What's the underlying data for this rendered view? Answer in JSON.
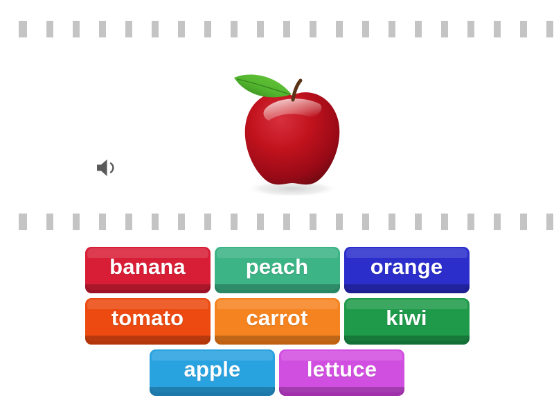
{
  "page": {
    "background_color": "#ffffff",
    "separator_color": "#c4c4c4"
  },
  "prompt": {
    "audio_button": {
      "icon": "speaker-icon",
      "label": "Play audio",
      "color": "#5a5a5a"
    },
    "image": {
      "name": "apple-photo",
      "alt": "A red apple with a green leaf",
      "colors": {
        "apple_body": "#c0121d",
        "apple_highlight": "#f2d9d4",
        "apple_dark": "#6e0a12",
        "leaf": "#49a72b",
        "leaf_dark": "#2f7d18",
        "stem": "#5b3316",
        "shadow": "#d9d9d9"
      }
    }
  },
  "answers": {
    "rows": [
      [
        {
          "label": "banana",
          "color": "#d81e36",
          "shadow": "#9e1227"
        },
        {
          "label": "peach",
          "color": "#3cb486",
          "shadow": "#2a8765"
        },
        {
          "label": "orange",
          "color": "#2b2ecb",
          "shadow": "#1d1f92"
        }
      ],
      [
        {
          "label": "tomato",
          "color": "#ec4a11",
          "shadow": "#b3350a"
        },
        {
          "label": "carrot",
          "color": "#f5831f",
          "shadow": "#c06111"
        },
        {
          "label": "kiwi",
          "color": "#1e9a4a",
          "shadow": "#137036"
        }
      ],
      [
        {
          "label": "apple",
          "color": "#29a3e0",
          "shadow": "#1c79a9"
        },
        {
          "label": "lettuce",
          "color": "#d14fe0",
          "shadow": "#a130ad"
        }
      ]
    ]
  }
}
